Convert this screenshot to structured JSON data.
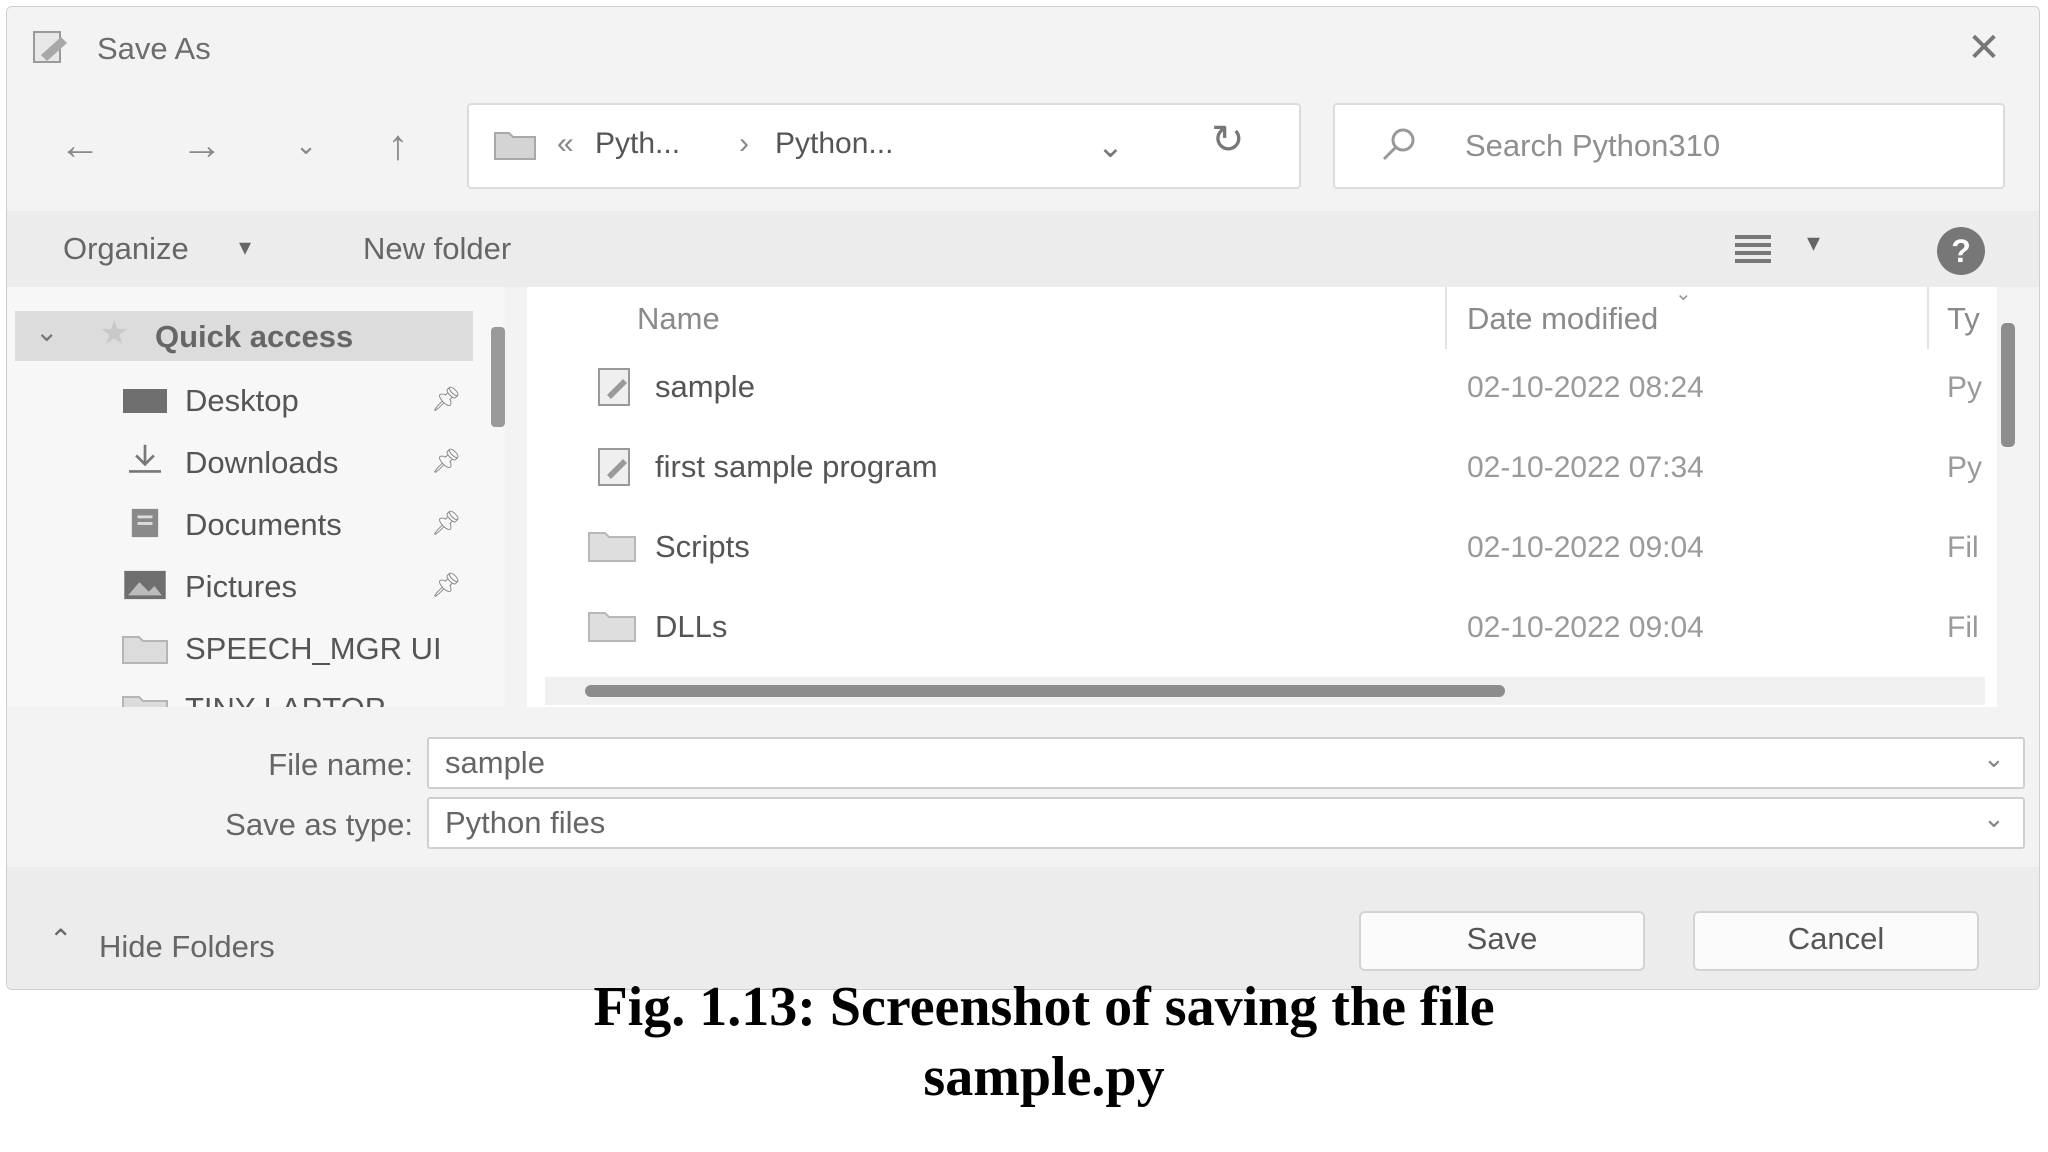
{
  "window": {
    "title": "Save As"
  },
  "address_bar": {
    "crumbs": [
      "Pyth...",
      "Python..."
    ]
  },
  "search": {
    "placeholder": "Search Python310"
  },
  "toolbar": {
    "organize_label": "Organize",
    "new_folder_label": "New folder"
  },
  "nav": {
    "quick_access": "Quick access",
    "items": [
      {
        "label": "Desktop",
        "pinned": true,
        "icon": "desktop-icon"
      },
      {
        "label": "Downloads",
        "pinned": true,
        "icon": "download-icon"
      },
      {
        "label": "Documents",
        "pinned": true,
        "icon": "documents-icon"
      },
      {
        "label": "Pictures",
        "pinned": true,
        "icon": "pictures-icon"
      },
      {
        "label": "SPEECH_MGR UI",
        "pinned": false,
        "icon": "folder-icon"
      },
      {
        "label": "TINY LAPTOP",
        "pinned": false,
        "icon": "folder-icon"
      }
    ]
  },
  "files": {
    "columns": {
      "name": "Name",
      "date": "Date modified",
      "type": "Ty"
    },
    "rows": [
      {
        "name": "sample",
        "date": "02-10-2022 08:24",
        "type": "Py",
        "icon": "python-file-icon"
      },
      {
        "name": "first sample program",
        "date": "02-10-2022 07:34",
        "type": "Py",
        "icon": "python-file-icon"
      },
      {
        "name": "Scripts",
        "date": "02-10-2022 09:04",
        "type": "Fil",
        "icon": "folder-icon"
      },
      {
        "name": "DLLs",
        "date": "02-10-2022 09:04",
        "type": "Fil",
        "icon": "folder-icon"
      }
    ]
  },
  "form": {
    "file_name_label": "File name:",
    "file_name_value": "sample",
    "save_type_label": "Save as type:",
    "save_type_value": "Python files"
  },
  "footer": {
    "hide_folders_label": "Hide Folders",
    "save_label": "Save",
    "cancel_label": "Cancel"
  },
  "caption": {
    "line1": "Fig. 1.13: Screenshot of saving the file",
    "line2": "sample.py"
  }
}
